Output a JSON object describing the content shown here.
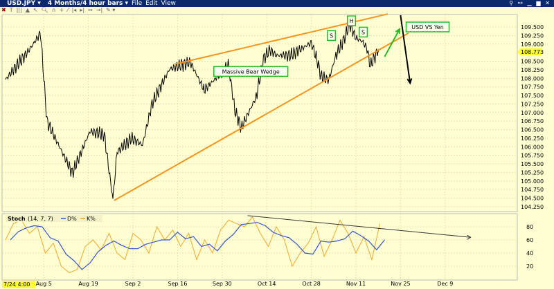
{
  "window": {
    "symbol": "USD.JPY",
    "period": "4 Months/4 hour bars",
    "menus": [
      "File",
      "Edit",
      "View"
    ]
  },
  "toolbar": {
    "icons": [
      "close-icon",
      "text-icon",
      "bars-icon",
      "mountain-icon",
      "cursor-icon",
      "zoom-icon",
      "magnet-icon",
      "crosshair-icon",
      "trend-icon",
      "shift-left-icon",
      "shift-right-icon",
      "zoom-out-icon",
      "zoom-in-icon",
      "tools-icon"
    ]
  },
  "colors": {
    "background": "#ffffd2",
    "price": "#000000",
    "wedge": "#f7941d",
    "arrow_up": "#22bb22",
    "arrow_down": "#000000",
    "d_line": "#3355cc",
    "k_line": "#f5a623",
    "label_box": "#22bb22",
    "current_price_bg": "#ffff33"
  },
  "price_axis": {
    "labels": [
      "109.500",
      "109.250",
      "109.000",
      "108.500",
      "108.250",
      "108.000",
      "107.750",
      "107.500",
      "107.250",
      "107.000",
      "106.750",
      "106.500",
      "106.250",
      "106.000",
      "105.750",
      "105.500",
      "105.250",
      "105.000",
      "104.750",
      "104.500",
      "104.250"
    ],
    "current": "108.773",
    "current_value": 108.773
  },
  "stoch_axis": {
    "labels": [
      "80",
      "60",
      "40",
      "20"
    ],
    "values": [
      80,
      60,
      40,
      20
    ]
  },
  "x_axis": {
    "cursor_label": "7/24 4:00",
    "labels": [
      {
        "text": "Aug 5",
        "day": 12
      },
      {
        "text": "Aug 19",
        "day": 26
      },
      {
        "text": "Sep 2",
        "day": 40
      },
      {
        "text": "Sep 16",
        "day": 54
      },
      {
        "text": "Sep 30",
        "day": 68
      },
      {
        "text": "Oct 14",
        "day": 82
      },
      {
        "text": "Oct 28",
        "day": 96
      },
      {
        "text": "Nov 11",
        "day": 110
      },
      {
        "text": "Nov 25",
        "day": 124
      },
      {
        "text": "Dec 9",
        "day": 138
      }
    ]
  },
  "stoch_legend": {
    "name": "Stoch",
    "params": "(14, 7, 7)",
    "d_label": "D%",
    "k_label": "K%"
  },
  "chart_data": {
    "type": "line",
    "title": "USD.JPY 4 Months/4 hour bars",
    "x_unit": "days since 7/24",
    "ylim": [
      104.25,
      109.75
    ],
    "price_series": {
      "day": [
        0,
        7,
        11,
        13,
        21,
        26.5,
        31,
        33.7,
        35,
        39.5,
        43,
        46,
        51.5,
        58,
        62.4,
        70,
        72,
        74,
        78.7,
        81,
        83,
        85,
        89.5,
        96,
        98,
        99,
        101,
        101.5,
        103.7,
        106,
        108,
        110,
        112,
        113.5,
        114.5,
        116.7,
        117.4
      ],
      "price": [
        107.96,
        108.77,
        109.32,
        106.75,
        105.23,
        106.45,
        106.35,
        104.47,
        105.84,
        106.25,
        106.05,
        107.26,
        108.27,
        108.47,
        107.66,
        108.37,
        107.06,
        106.55,
        107.46,
        108.57,
        108.83,
        108.67,
        108.67,
        109.04,
        108.47,
        108.07,
        107.96,
        107.96,
        108.67,
        109.08,
        109.58,
        109.18,
        109.08,
        108.87,
        108.37,
        108.77,
        108.77
      ]
    },
    "stochastic": {
      "ylim": [
        0,
        100
      ],
      "step_days": 2.5,
      "d_smoothing": 3,
      "k": [
        60,
        85,
        90,
        70,
        80,
        40,
        55,
        20,
        10,
        15,
        50,
        60,
        45,
        70,
        40,
        30,
        70,
        60,
        40,
        80,
        60,
        75,
        50,
        70,
        30,
        60,
        40,
        75,
        90,
        85,
        80,
        95,
        70,
        50,
        80,
        60,
        20,
        40,
        55,
        80,
        35,
        60,
        90,
        70,
        40,
        65,
        30,
        85
      ]
    },
    "trendlines": [
      {
        "name": "wedge-upper",
        "from": [
          53,
          108.41
        ],
        "to": [
          120,
          109.88
        ]
      },
      {
        "name": "wedge-lower",
        "from": [
          34.1,
          104.43
        ],
        "to": [
          126.5,
          109.32
        ]
      }
    ],
    "arrows": [
      {
        "name": "up-arrow",
        "from": [
          119,
          108.63
        ],
        "to": [
          123.7,
          109.44
        ]
      },
      {
        "name": "down-arrow",
        "from": [
          124,
          109.84
        ],
        "to": [
          127,
          107.86
        ]
      }
    ],
    "stoch_trendline": {
      "from": [
        76,
        97
      ],
      "to": [
        146,
        64
      ]
    },
    "annotations": [
      {
        "text": "Massive Bear Wedge",
        "day": 77,
        "price": 108.2
      },
      {
        "text": "S",
        "day": 102.3,
        "price": 109.25
      },
      {
        "text": "H",
        "day": 108.6,
        "price": 109.68
      },
      {
        "text": "S",
        "day": 112.3,
        "price": 109.35
      },
      {
        "text": "USD VS Yen",
        "day": 132.5,
        "price": 109.5
      }
    ]
  }
}
